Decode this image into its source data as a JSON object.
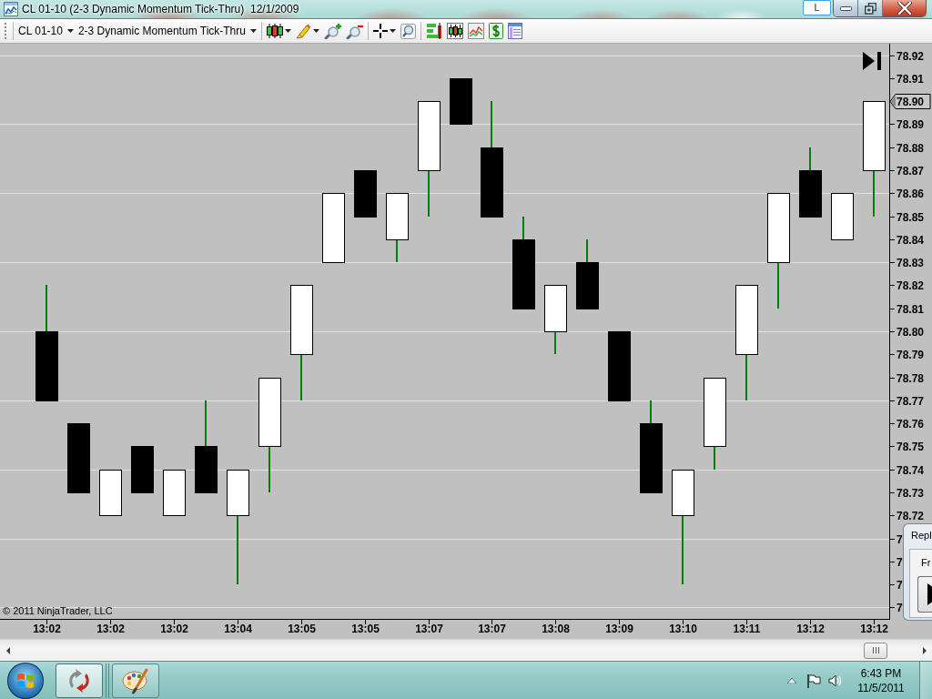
{
  "window": {
    "title": "CL 01-10 (2-3 Dynamic Momentum Tick-Thru)  12/1/2009",
    "language_button": "L"
  },
  "toolbar": {
    "instrument": "CL 01-10",
    "period_type": "2-3 Dynamic Momentum Tick-Thru"
  },
  "chart": {
    "copyright": "© 2011 NinjaTrader, LLC",
    "partial_axis_labels": [
      "7",
      "7",
      "7",
      "7"
    ],
    "chart_data": {
      "type": "candlestick",
      "categories": [
        "13:02",
        null,
        "13:02",
        null,
        "13:02",
        null,
        "13:04",
        null,
        "13:05",
        null,
        "13:05",
        null,
        "13:07",
        null,
        "13:07",
        null,
        "13:08",
        null,
        "13:09",
        null,
        "13:10",
        null,
        "13:11",
        null,
        "13:12",
        null,
        "13:12"
      ],
      "ohlc": [
        [
          78.8,
          78.82,
          78.77,
          78.77
        ],
        [
          78.76,
          78.76,
          78.73,
          78.73
        ],
        [
          78.72,
          78.74,
          78.72,
          78.74
        ],
        [
          78.75,
          78.75,
          78.73,
          78.73
        ],
        [
          78.72,
          78.74,
          78.72,
          78.74
        ],
        [
          78.75,
          78.77,
          78.73,
          78.73
        ],
        [
          78.72,
          78.74,
          78.69,
          78.74
        ],
        [
          78.75,
          78.78,
          78.73,
          78.78
        ],
        [
          78.79,
          78.82,
          78.77,
          78.82
        ],
        [
          78.83,
          78.86,
          78.83,
          78.86
        ],
        [
          78.87,
          78.87,
          78.85,
          78.85
        ],
        [
          78.84,
          78.86,
          78.83,
          78.86
        ],
        [
          78.87,
          78.9,
          78.85,
          78.9
        ],
        [
          78.91,
          78.91,
          78.89,
          78.89
        ],
        [
          78.88,
          78.9,
          78.85,
          78.85
        ],
        [
          78.84,
          78.85,
          78.81,
          78.81
        ],
        [
          78.8,
          78.82,
          78.79,
          78.82
        ],
        [
          78.83,
          78.84,
          78.81,
          78.81
        ],
        [
          78.8,
          78.8,
          78.77,
          78.77
        ],
        [
          78.76,
          78.77,
          78.73,
          78.73
        ],
        [
          78.72,
          78.74,
          78.69,
          78.74
        ],
        [
          78.75,
          78.78,
          78.74,
          78.78
        ],
        [
          78.79,
          78.82,
          78.77,
          78.82
        ],
        [
          78.83,
          78.86,
          78.81,
          78.86
        ],
        [
          78.87,
          78.88,
          78.85,
          78.85
        ],
        [
          78.84,
          78.86,
          78.84,
          78.86
        ],
        [
          78.87,
          78.9,
          78.85,
          78.9
        ]
      ],
      "ylim": [
        78.675,
        78.925
      ],
      "yticks": [
        78.72,
        78.73,
        78.74,
        78.75,
        78.76,
        78.77,
        78.78,
        78.79,
        {
          "value": 78.8,
          "label": "78.80"
        },
        78.81,
        78.82,
        78.83,
        78.84,
        78.85,
        78.86,
        78.87,
        78.88,
        78.89,
        {
          "value": 78.9,
          "label": "78.90"
        },
        78.91,
        78.92
      ],
      "grid": true
    }
  },
  "replay_window": {
    "title": "Repl",
    "label": "Fr"
  },
  "taskbar": {
    "apps": [
      {
        "kind": "ninjatrader",
        "selected": true
      },
      {
        "kind": "paint",
        "selected": false
      }
    ],
    "clock": {
      "time": "6:43 PM",
      "date": "11/5/2011"
    }
  }
}
